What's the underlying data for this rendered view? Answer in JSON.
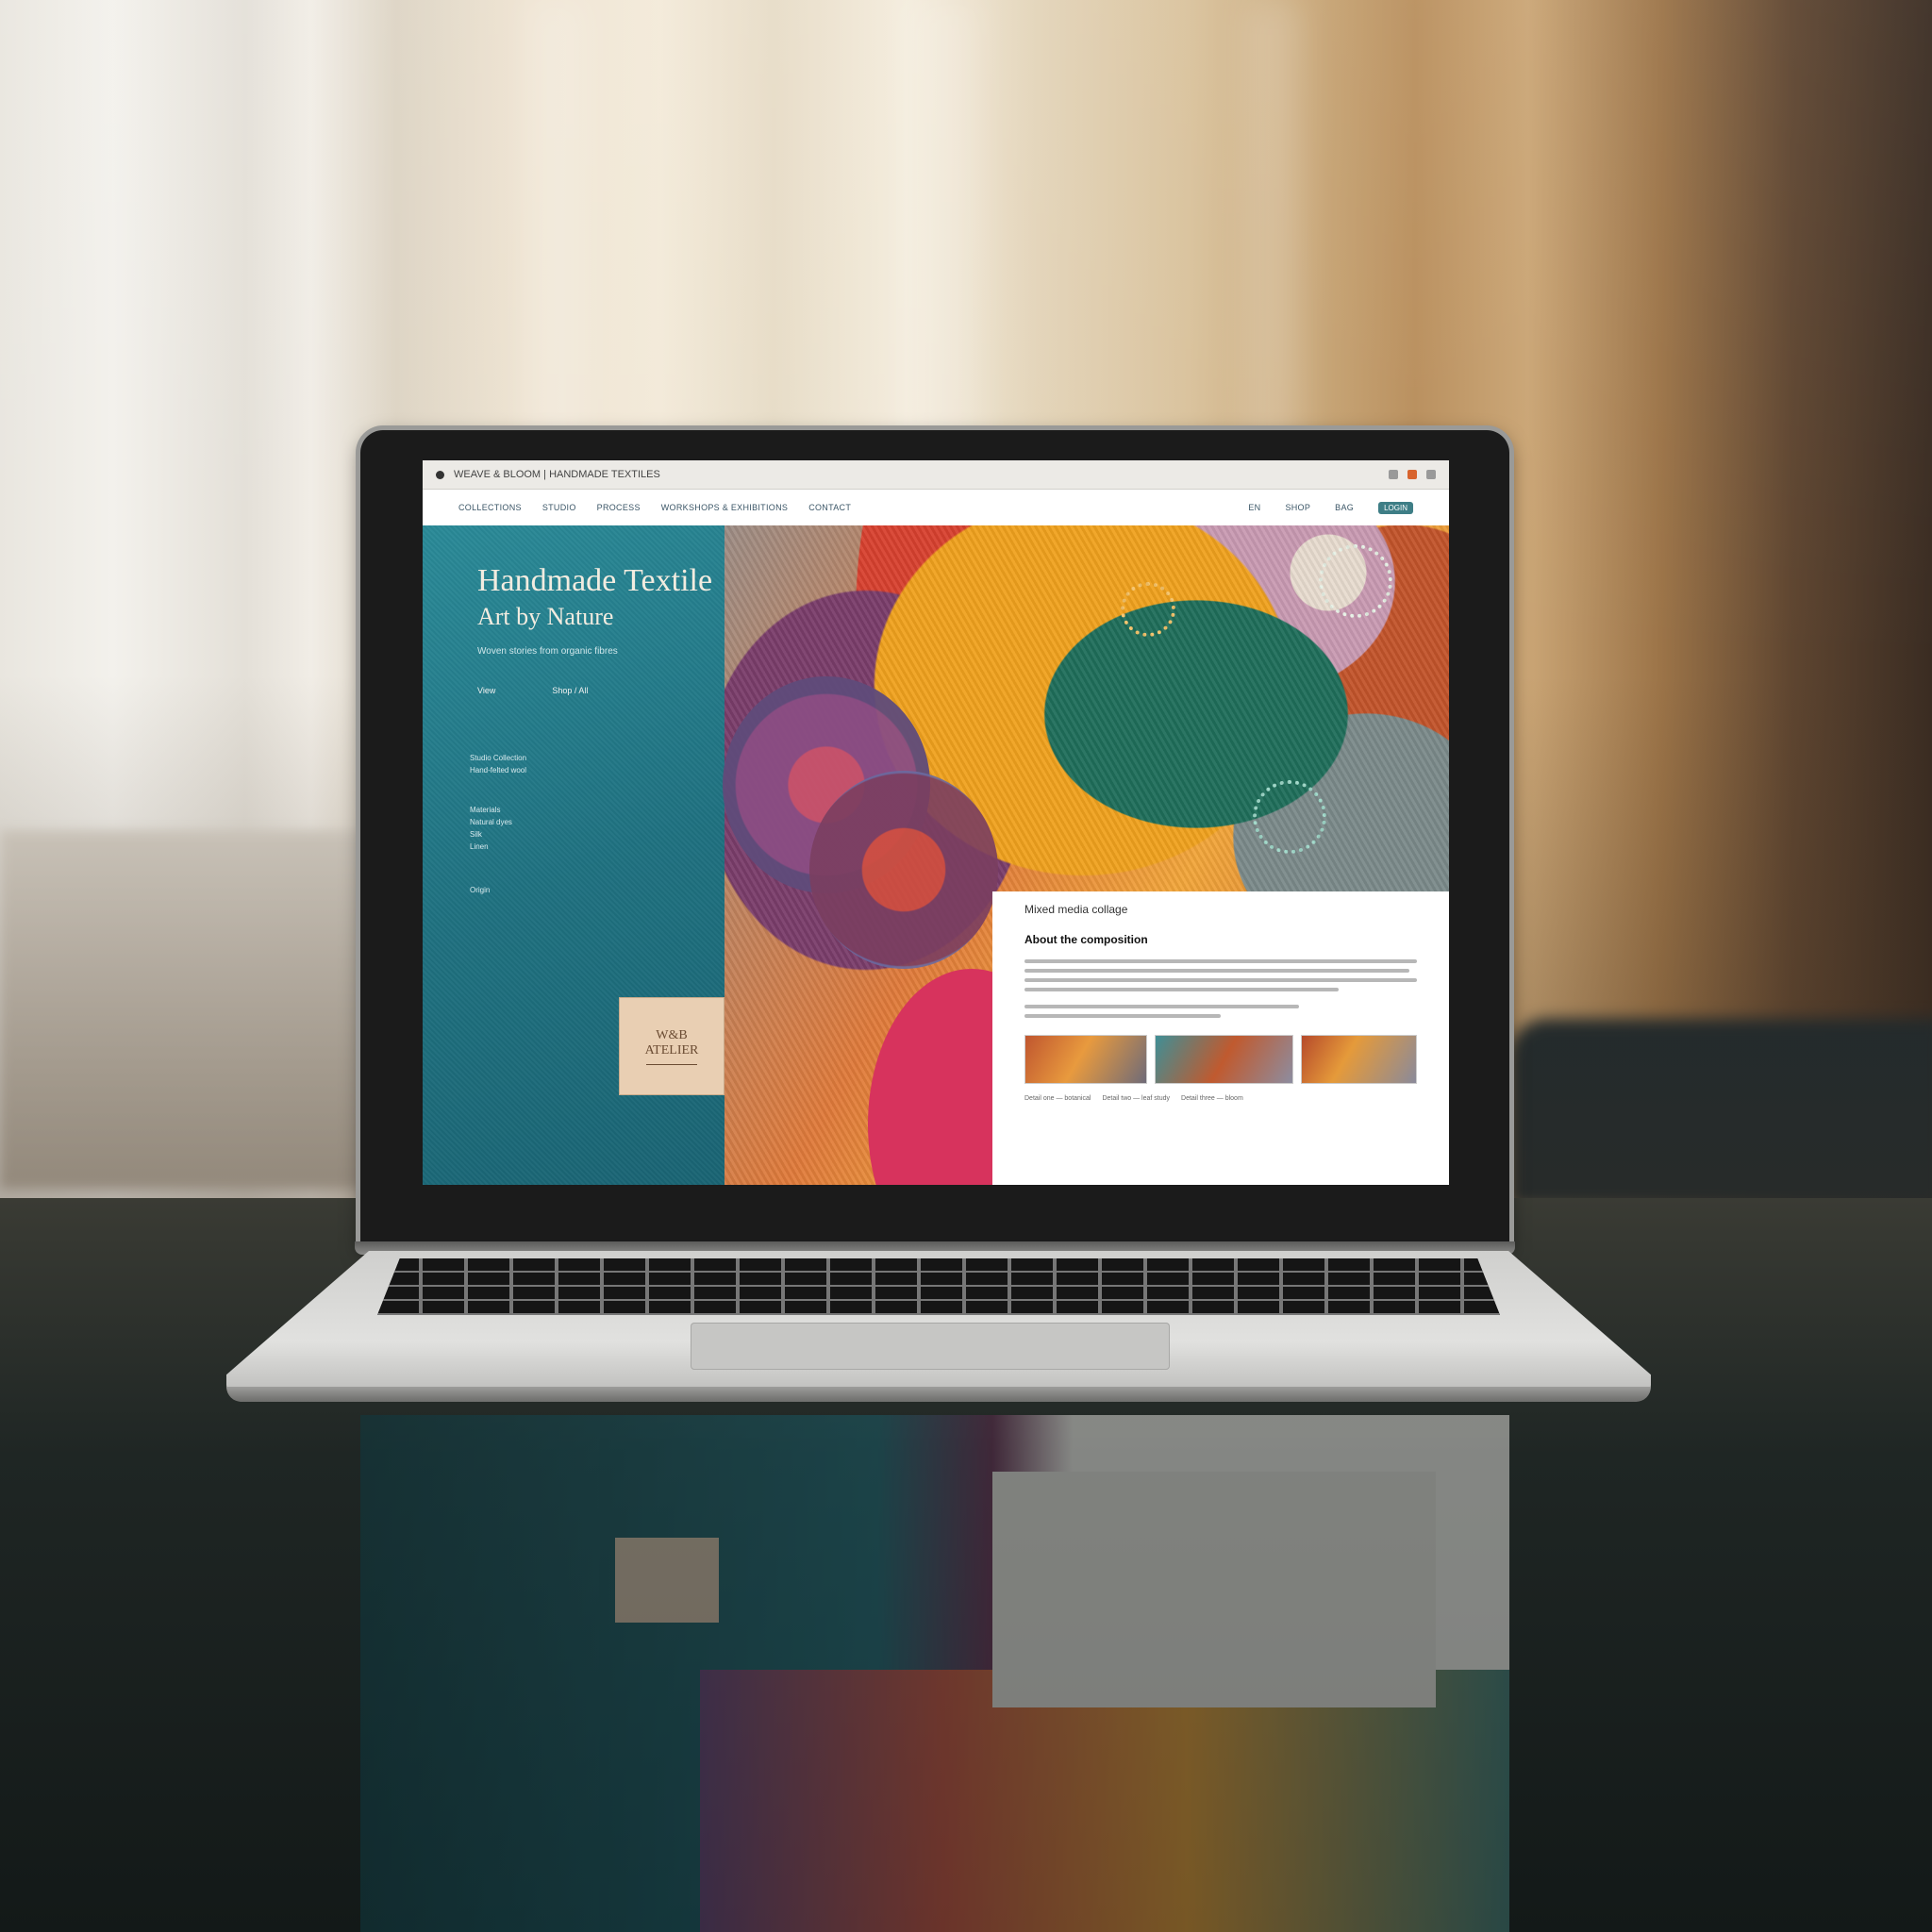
{
  "browser": {
    "url_text": "WEAVE & BLOOM | HANDMADE TEXTILES"
  },
  "nav": {
    "links": [
      "COLLECTIONS",
      "STUDIO",
      "PROCESS",
      "WORKSHOPS & EXHIBITIONS",
      "CONTACT"
    ],
    "right": [
      "EN",
      "SHOP",
      "BAG",
      "LOGIN"
    ]
  },
  "hero": {
    "title_line1": "Handmade Textile",
    "title_line2": "Art by Nature",
    "subtitle": "Woven stories from organic fibres",
    "links": [
      "View",
      "Shop / All"
    ],
    "meta_block1": [
      "Studio Collection",
      "Hand-felted wool"
    ],
    "meta_block2": [
      "Materials",
      "Natural dyes",
      "Silk",
      "Linen"
    ],
    "meta_block3": [
      "Origin"
    ],
    "badge_lines": [
      "W&B",
      "ATELIER"
    ]
  },
  "card": {
    "kicker": "Mixed media collage",
    "title": "About the composition",
    "captions": [
      "Detail one — botanical",
      "Detail two — leaf study",
      "Detail three — bloom"
    ]
  },
  "colors": {
    "teal": "#1f7180",
    "pink": "#d7335d",
    "orange": "#e07a3a",
    "badge": "#e9cfb3"
  }
}
